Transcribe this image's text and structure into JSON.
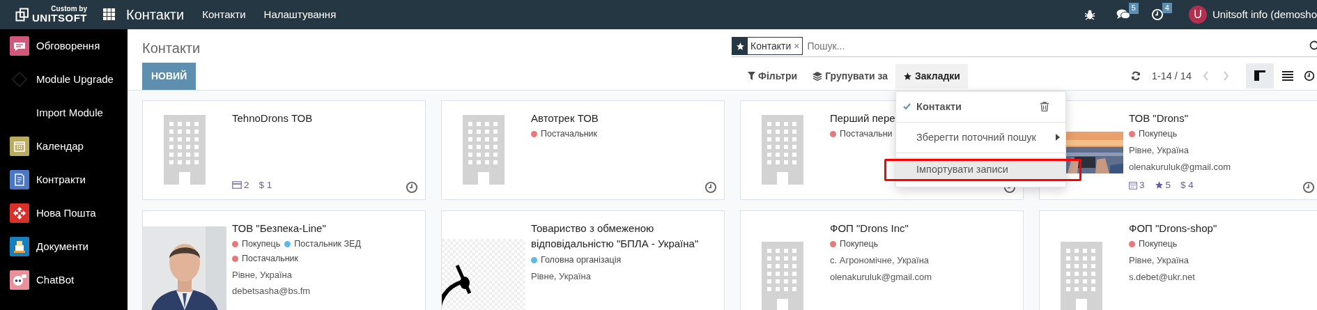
{
  "topbar": {
    "logo": {
      "line1": "Custom by",
      "line2": "UNITSOFT"
    },
    "app_title": "Контакти",
    "menu": [
      "Контакти",
      "Налаштування"
    ],
    "systray": [
      {
        "kind": "bug"
      },
      {
        "kind": "chat",
        "badge": "5"
      },
      {
        "kind": "clock",
        "badge": "4"
      }
    ],
    "user": {
      "initial": "U",
      "name": "Unitsoft info (demosho"
    }
  },
  "sidebar": {
    "items": [
      {
        "kind": "chat",
        "label": "Обговорення"
      },
      {
        "kind": "module",
        "label": "Module Upgrade"
      },
      {
        "kind": "none",
        "label": "Import Module"
      },
      {
        "kind": "calendar",
        "label": "Календар"
      },
      {
        "kind": "contract",
        "label": "Контракти"
      },
      {
        "kind": "post",
        "label": "Нова Пошта"
      },
      {
        "kind": "docs",
        "label": "Документи"
      },
      {
        "kind": "bot",
        "label": "ChatBot"
      }
    ]
  },
  "control_panel": {
    "title": "Контакти",
    "new_button": "НОВИЙ",
    "search": {
      "facet": "Контакти",
      "facet_remove": "×",
      "placeholder": "Пошук..."
    },
    "filters": [
      {
        "kind": "filter",
        "label": "Фільтри",
        "open": false
      },
      {
        "kind": "group",
        "label": "Групувати за",
        "open": false
      },
      {
        "kind": "favorite",
        "label": "Закладки",
        "open": true
      }
    ],
    "favorites_menu": [
      {
        "kind": "saved",
        "label": "Контакти",
        "checked": true,
        "hovered": false,
        "outlined": false
      },
      {
        "kind": "submenu",
        "label": "Зберегти поточний пошук",
        "hovered": false,
        "outlined": false
      },
      {
        "kind": "action",
        "label": "Імпортувати записи",
        "hovered": true,
        "outlined": true
      }
    ],
    "pager": "1-14 / 14",
    "views": [
      {
        "kind": "kanban",
        "selected": true
      },
      {
        "kind": "list",
        "selected": false
      },
      {
        "kind": "activity",
        "selected": false
      }
    ]
  },
  "kanban": {
    "cards": [
      {
        "kind": "placeholder",
        "title": "TehnoDrons ТОВ",
        "stats": [
          {
            "kind": "card",
            "value": "2"
          },
          {
            "kind": "plain",
            "value": "$ 1"
          }
        ],
        "activity": true
      },
      {
        "kind": "placeholder",
        "title": "Автотрек ТОВ",
        "tags": [
          {
            "label": "Постачальник",
            "color": "#e8797b"
          }
        ],
        "activity": true
      },
      {
        "kind": "placeholder",
        "title": "Перший пере",
        "tags": [
          {
            "label": "Постачальни",
            "color": "#e8797b"
          }
        ],
        "activity": true
      },
      {
        "kind": "picture",
        "title": "ТОВ \"Drons\"",
        "tags": [
          {
            "label": "Покупець",
            "color": "#e8797b"
          }
        ],
        "lines": [
          "Рівне, Україна",
          "olenakuruluk@gmail.com"
        ],
        "stats": [
          {
            "kind": "calendar",
            "value": "3"
          },
          {
            "kind": "star",
            "value": "5"
          },
          {
            "kind": "plain",
            "value": "$ 4"
          }
        ],
        "activity": true
      },
      {
        "kind": "picture",
        "title": "ТОВ \"Безпека-Line\"",
        "tags": [
          {
            "label": "Покупець",
            "color": "#e8797b"
          },
          {
            "label": "Постальник ЗЕД",
            "color": "#5cb9ea"
          },
          {
            "label": "Постачальник",
            "color": "#e8797b"
          }
        ],
        "lines": [
          "Рівне, Україна",
          "debetsasha@bs.fm"
        ],
        "activity": false
      },
      {
        "kind": "picture",
        "title": "Товариство з обмеженою відповідальністю \"БПЛА - Україна\"",
        "tags": [
          {
            "label": "Головна організація",
            "color": "#5cb9ea"
          }
        ],
        "lines": [
          "Рівне, Україна"
        ],
        "activity": false
      },
      {
        "kind": "placeholder",
        "title": "ФОП \"Drons Inc\"",
        "tags": [
          {
            "label": "Покупець",
            "color": "#e8797b"
          }
        ],
        "lines": [
          "с. Агрономічне, Україна",
          "olenakuruluk@gmail.com"
        ],
        "activity": false
      },
      {
        "kind": "placeholder",
        "title": "ФОП \"Drons-shop\"",
        "tags": [
          {
            "label": "Покупець",
            "color": "#e8797b"
          }
        ],
        "lines": [
          "Рівне, Україна",
          "s.debet@ukr.net"
        ],
        "activity": false
      }
    ]
  }
}
